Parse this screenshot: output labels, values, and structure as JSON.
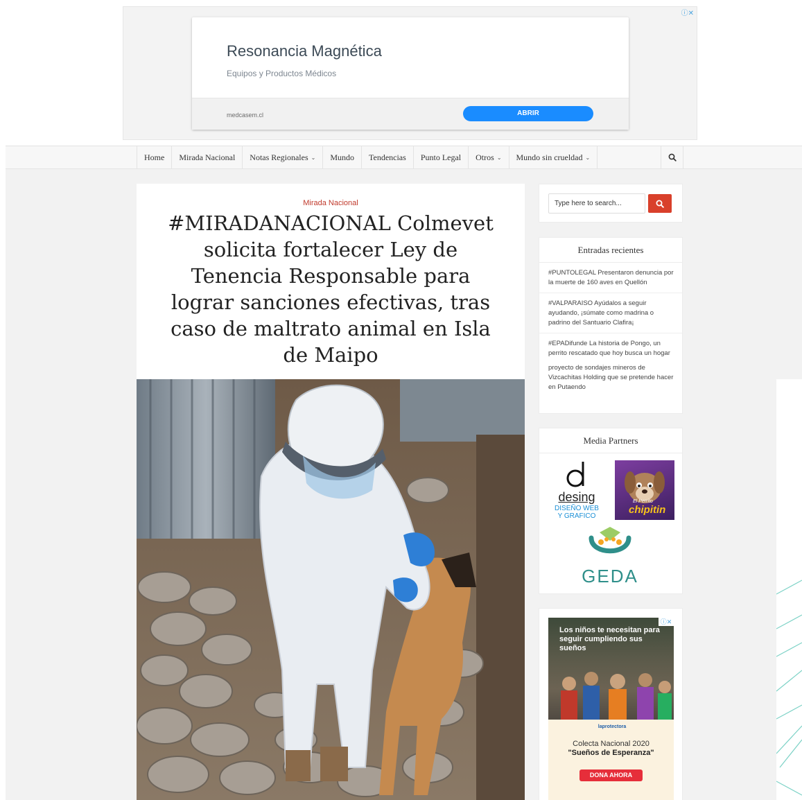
{
  "top_ad": {
    "title": "Resonancia Magnética",
    "subtitle": "Equipos y Productos Médicos",
    "domain": "medcasem.cl",
    "button": "ABRIR",
    "adchoices": "ⓘ✕"
  },
  "nav": {
    "items": [
      {
        "label": "Home",
        "dropdown": false
      },
      {
        "label": "Mirada Nacional",
        "dropdown": false
      },
      {
        "label": "Notas Regionales",
        "dropdown": true
      },
      {
        "label": "Mundo",
        "dropdown": false
      },
      {
        "label": "Tendencias",
        "dropdown": false
      },
      {
        "label": "Punto Legal",
        "dropdown": false
      },
      {
        "label": "Otros",
        "dropdown": true
      },
      {
        "label": "Mundo sin crueldad",
        "dropdown": true
      }
    ],
    "search_icon": "search-icon"
  },
  "article": {
    "category": "Mirada Nacional",
    "title": "#MIRADANACIONAL Colmevet solicita fortalecer Ley de Tenencia Responsable para lograr sanciones efectivas, tras caso de maltrato animal en Isla de Maipo"
  },
  "sidebar": {
    "search": {
      "placeholder": "Type here to search..."
    },
    "recent": {
      "title": "Entradas recientes",
      "items": [
        "#PUNTOLEGAL Presentaron denuncia por la muerte de 160 aves en Quellón",
        "#VALPARAISO Ayúdalos a seguir ayudando, ¡súmate como madrina o padrino del Santuario Clafira¡",
        "#EPADifunde La historia de Pongo, un perrito rescatado que hoy busca un hogar",
        "proyecto de sondajes mineros de Vizcachitas Holding que se pretende hacer en Putaendo"
      ]
    },
    "partners": {
      "title": "Media Partners",
      "desing": {
        "name": "desing",
        "tagline1": "DISEÑO WEB",
        "tagline2": "Y GRAFICO"
      },
      "chipitin": {
        "line1": "El Perrito",
        "line2": "chipitin"
      },
      "geda": "GEDA"
    },
    "ad": {
      "headline": "Los niños te necesitan para seguir cumpliendo sus sueños",
      "logo": "laprotectora",
      "campaign_line1": "Colecta Nacional 2020",
      "campaign_line2": "\"Sueños de Esperanza\"",
      "button": "DONA AHORA",
      "adchoices": "ⓘ✕"
    }
  },
  "colors": {
    "accent_red": "#d9402b",
    "category_red": "#c0392b",
    "ad_blue": "#1a8cff",
    "geda_teal": "#2f8f8a"
  }
}
